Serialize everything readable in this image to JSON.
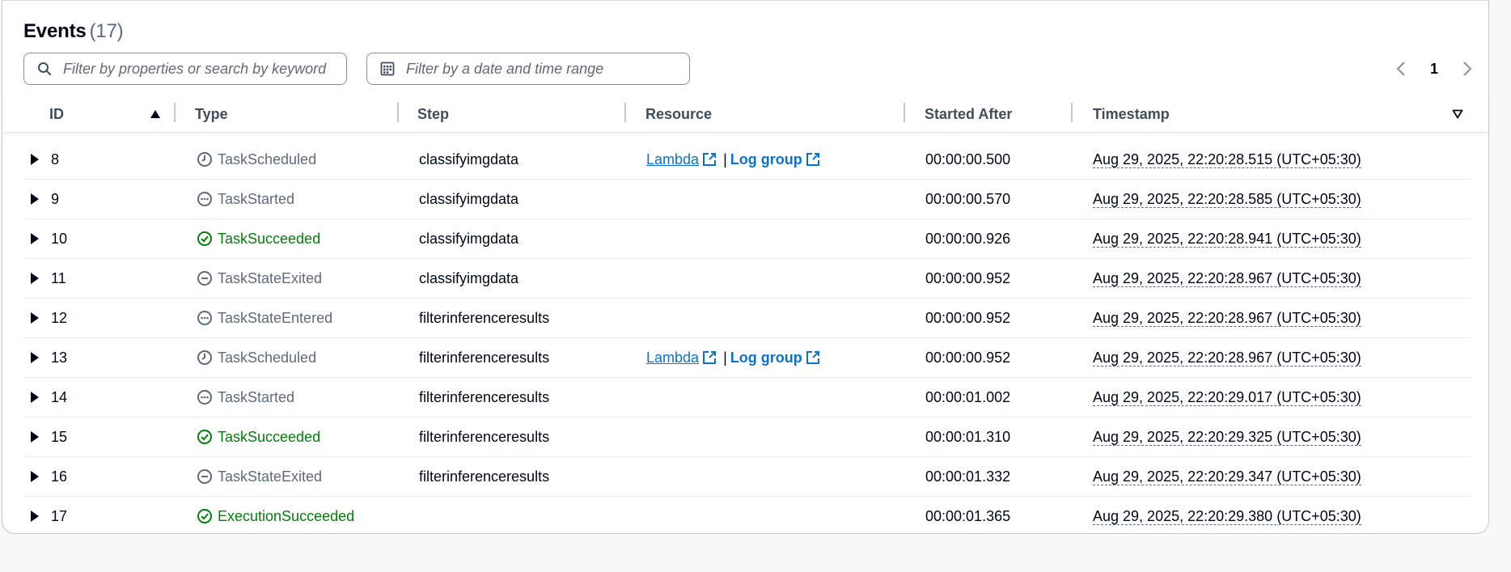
{
  "header": {
    "title": "Events",
    "count": "(17)"
  },
  "filters": {
    "search_placeholder": "Filter by properties or search by keyword",
    "date_placeholder": "Filter by a date and time range"
  },
  "pagination": {
    "current_page": "1"
  },
  "columns": {
    "id": "ID",
    "type": "Type",
    "step": "Step",
    "resource": "Resource",
    "started_after": "Started After",
    "timestamp": "Timestamp"
  },
  "resource_labels": {
    "lambda": "Lambda",
    "separator": "|",
    "log_group": "Log group"
  },
  "colors": {
    "success": "#037f0c",
    "neutral": "#5f6b7a",
    "link": "#0972d3"
  },
  "rows": [
    {
      "id": "8",
      "type": "TaskScheduled",
      "status": "scheduled",
      "step": "classifyimgdata",
      "has_resource": true,
      "started_after": "00:00:00.500",
      "timestamp": "Aug 29, 2025, 22:20:28.515 (UTC+05:30)"
    },
    {
      "id": "9",
      "type": "TaskStarted",
      "status": "pending",
      "step": "classifyimgdata",
      "has_resource": false,
      "started_after": "00:00:00.570",
      "timestamp": "Aug 29, 2025, 22:20:28.585 (UTC+05:30)"
    },
    {
      "id": "10",
      "type": "TaskSucceeded",
      "status": "success",
      "step": "classifyimgdata",
      "has_resource": false,
      "started_after": "00:00:00.926",
      "timestamp": "Aug 29, 2025, 22:20:28.941 (UTC+05:30)"
    },
    {
      "id": "11",
      "type": "TaskStateExited",
      "status": "stopped",
      "step": "classifyimgdata",
      "has_resource": false,
      "started_after": "00:00:00.952",
      "timestamp": "Aug 29, 2025, 22:20:28.967 (UTC+05:30)"
    },
    {
      "id": "12",
      "type": "TaskStateEntered",
      "status": "pending",
      "step": "filterinferenceresults",
      "has_resource": false,
      "started_after": "00:00:00.952",
      "timestamp": "Aug 29, 2025, 22:20:28.967 (UTC+05:30)"
    },
    {
      "id": "13",
      "type": "TaskScheduled",
      "status": "scheduled",
      "step": "filterinferenceresults",
      "has_resource": true,
      "started_after": "00:00:00.952",
      "timestamp": "Aug 29, 2025, 22:20:28.967 (UTC+05:30)"
    },
    {
      "id": "14",
      "type": "TaskStarted",
      "status": "pending",
      "step": "filterinferenceresults",
      "has_resource": false,
      "started_after": "00:00:01.002",
      "timestamp": "Aug 29, 2025, 22:20:29.017 (UTC+05:30)"
    },
    {
      "id": "15",
      "type": "TaskSucceeded",
      "status": "success",
      "step": "filterinferenceresults",
      "has_resource": false,
      "started_after": "00:00:01.310",
      "timestamp": "Aug 29, 2025, 22:20:29.325 (UTC+05:30)"
    },
    {
      "id": "16",
      "type": "TaskStateExited",
      "status": "stopped",
      "step": "filterinferenceresults",
      "has_resource": false,
      "started_after": "00:00:01.332",
      "timestamp": "Aug 29, 2025, 22:20:29.347 (UTC+05:30)"
    },
    {
      "id": "17",
      "type": "ExecutionSucceeded",
      "status": "success",
      "step": "",
      "has_resource": false,
      "started_after": "00:00:01.365",
      "timestamp": "Aug 29, 2025, 22:20:29.380 (UTC+05:30)"
    }
  ]
}
